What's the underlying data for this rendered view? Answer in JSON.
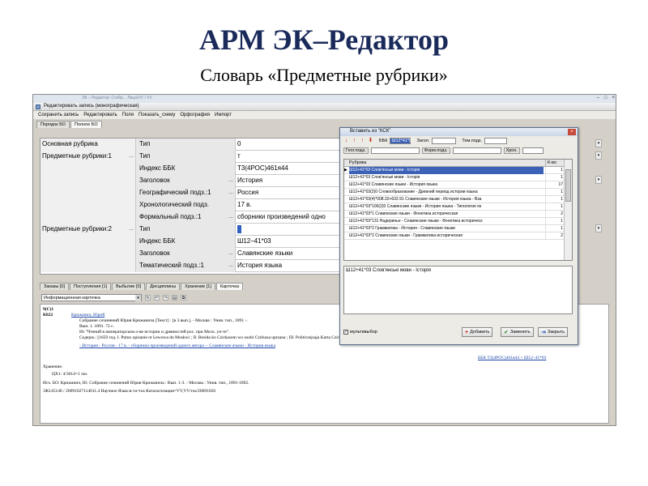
{
  "slide": {
    "title": "АРМ ЭК–Редактор",
    "subtitle": "Словарь «Предметные рубрики»"
  },
  "window": {
    "titlebar": "ЭК – Редактор: Стабр... Лица\\VV  / VV",
    "record_title": "Редактировать запись (монографическая)"
  },
  "menu": [
    "Сохранить запись",
    "Редактировать",
    "Поля",
    "Показать_схему",
    "Орфография",
    "Импорт"
  ],
  "top_tabs": [
    "Порядок БО",
    "Полное БО"
  ],
  "grid": {
    "rows": [
      {
        "c1": "Основная рубрика",
        "c2": "Тип",
        "c3": "0"
      },
      {
        "c1": "Предметные рубрики:1",
        "c2": "Тип",
        "c3": "т"
      },
      {
        "c1": "",
        "c2": "Индекс ББК",
        "c3": "Т3(4РОС)461я44"
      },
      {
        "c1": "",
        "c2": "Заголовок",
        "c3": "История"
      },
      {
        "c1": "",
        "c2": "Географический подз.:1",
        "c3": "Россия"
      },
      {
        "c1": "",
        "c2": "Хронологический подз.",
        "c3": "17 в."
      },
      {
        "c1": "",
        "c2": "Формальный подз.:1",
        "c3": "сборники произведений одно"
      },
      {
        "c1": "Предметные рубрики:2",
        "c2": "Тип",
        "c3": ""
      },
      {
        "c1": "",
        "c2": "Индекс ББК",
        "c3": "Ш12–41*03"
      },
      {
        "c1": "",
        "c2": "Заголовок",
        "c3": "Славянские языки"
      },
      {
        "c1": "",
        "c2": "Тематический подз.:1",
        "c3": "История языка"
      }
    ]
  },
  "bottom_tabs": [
    "Заказы [0]",
    "Поступления [1]",
    "Выбытие [0]",
    "Дисциплины",
    "Хранение [1]",
    "Карточка"
  ],
  "format_select": "Информационная карточка",
  "card_lines": {
    "l1": "9(С)1",
    "l2": "К822",
    "l2b": "Крижанич, Юрий",
    "l3": "Собрание сочинений Юрия Крижанича [Текст] : [в 3 вып.]. - Москва : Унив. тип., 1891 -.",
    "l4": "Вып. 1.   1891.   72 с.",
    "l5": "Из \"Чтений в императорском о-ве истории и древностей рос. при Моск. ун-те\".",
    "l6": "Содерж.: [1659 год. I. Putno opisanie ot Lewowa do Moskwi ; II. Besida ko Czirkasom wo osobi Czirkasa uprsana ; III. Politiczejsaja Karta Czirkasowa]",
    "l7": "- История - Россия - 17 в. - сборники произведений одного автора -- Славянские языки - История языка",
    "bbk": "ББК Т3(4РОС)461я44 + Ш12–41*03",
    "l8": "Хранение:",
    "l9": "ЦХ1: 4/3014=1 экз.",
    "l10": "Исх. БО: Крижанич, Ю. Собрание сочинений Юрия Крижанича : Вып. 1-3. - Москва : Унив. тип., 1891-1892.",
    "l11": "ЭК145146 / 20091027114611.4 Научное   Язык:в-та=rus  Каталогизация=VV,VV/rus/20091026"
  },
  "dialog": {
    "title": "Вставить из \"КСК\"",
    "bbk_label": "ББК",
    "bbk_value": "Ш12*41*03",
    "zag_label": "Загол.",
    "temp_label": "Тем.подз.",
    "geo_label": "Геог.подз.",
    "form_label": "Форм.подз.",
    "hron_label": "Хрон.",
    "headers": {
      "name": "Рубрика",
      "count": "К-во"
    },
    "rows": [
      {
        "text": "Ш12+41*03   Слов'янськi мови - Історія",
        "count": "1",
        "sel": true
      },
      {
        "text": "Ш12+41*03   Слов'янськi мови - Історія",
        "count": "1"
      },
      {
        "text": "Ш12+41*03   Славянские языки - История языка",
        "count": "17"
      },
      {
        "text": "Ш12+41*03(2)0  Словообразование - Древний период истории языка",
        "count": "1"
      },
      {
        "text": "Ш12+41*03(4)*008.32+632.91  Славянские языки - История языка - Вза",
        "count": "1"
      },
      {
        "text": "Ш12+41*03*100(2)0  Славянские языки - История языка - Типология яз",
        "count": "1"
      },
      {
        "text": "Ш12+41*03*1   Славянские языки - Фонетика историческая",
        "count": "2"
      },
      {
        "text": "Ш12+41*03*131   Надеринье - Славянские языки - Фонетика историческ",
        "count": "1"
      },
      {
        "text": "Ш12+41*03*2   Грамматика - История - Славянские языки",
        "count": "1"
      },
      {
        "text": "Ш12+41*03*2   Славянские языки - Грамматика историческая",
        "count": "2"
      }
    ],
    "preview": "Ш12+41*03   Слов'янськi мови - Історія",
    "multi_label": "мультивыбор",
    "add_btn": "Добавить",
    "replace_btn": "Заменить",
    "close_btn": "Закрыть"
  }
}
